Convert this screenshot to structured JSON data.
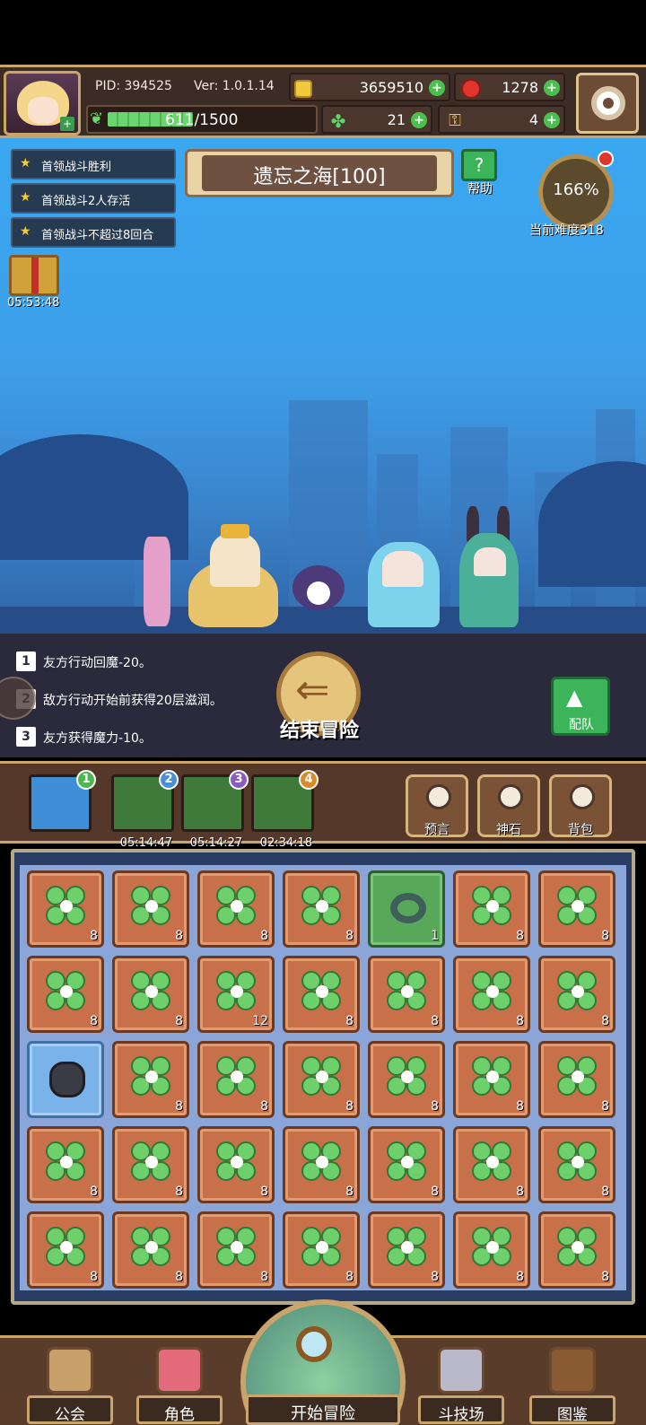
{
  "header": {
    "pid": "PID: 394525",
    "version": "Ver: 1.0.1.14",
    "gold": "3659510",
    "gems": "1278",
    "energy": "611/1500",
    "energy_fraction": 0.41,
    "clovers": "21",
    "keys": "4",
    "icons": {
      "gold": "coin-icon",
      "gems": "red-gem-icon",
      "clovers": "clover-icon",
      "keys": "key-icon",
      "settings": "gear-icon",
      "energy": "leaf-icon"
    }
  },
  "quests": [
    {
      "label": "首领战斗胜利"
    },
    {
      "label": "首领战斗2人存活"
    },
    {
      "label": "首领战斗不超过8回合"
    }
  ],
  "gift": {
    "timer": "05:53:48"
  },
  "stage": {
    "name": "遗忘之海[100]",
    "help_label": "帮助",
    "difficulty_pct": "166%",
    "difficulty_label": "当前难度318"
  },
  "battle_log": [
    {
      "num": "1",
      "text": "友方行动回魔-20。"
    },
    {
      "num": "2",
      "text": "敌方行动开始前获得20层滋润。"
    },
    {
      "num": "3",
      "text": "友方获得魔力-10。"
    }
  ],
  "actions": {
    "end_label": "结束冒险",
    "team_label": "配队"
  },
  "slots": [
    {
      "badge": "1",
      "timer": "",
      "color": "#4fb653"
    },
    {
      "badge": "2",
      "timer": "05:14:47",
      "color": "#4a8fd8"
    },
    {
      "badge": "3",
      "timer": "05:14:27",
      "color": "#8a5bc2"
    },
    {
      "badge": "4",
      "timer": "02:34:18",
      "color": "#d98a2b"
    }
  ],
  "tools": [
    {
      "label": "预言"
    },
    {
      "label": "神石"
    },
    {
      "label": "背包"
    }
  ],
  "inventory": [
    [
      "8",
      "8",
      "8",
      "8",
      "1",
      "8",
      "8"
    ],
    [
      "8",
      "8",
      "12",
      "8",
      "8",
      "8",
      "8"
    ],
    [
      "",
      "8",
      "8",
      "8",
      "8",
      "8",
      "8"
    ],
    [
      "8",
      "8",
      "8",
      "8",
      "8",
      "8",
      "8"
    ],
    [
      "8",
      "8",
      "8",
      "8",
      "8",
      "8",
      "8"
    ]
  ],
  "nav": {
    "guild": "公会",
    "character": "角色",
    "start": "开始冒险",
    "arena": "斗技场",
    "codex": "图鉴"
  }
}
